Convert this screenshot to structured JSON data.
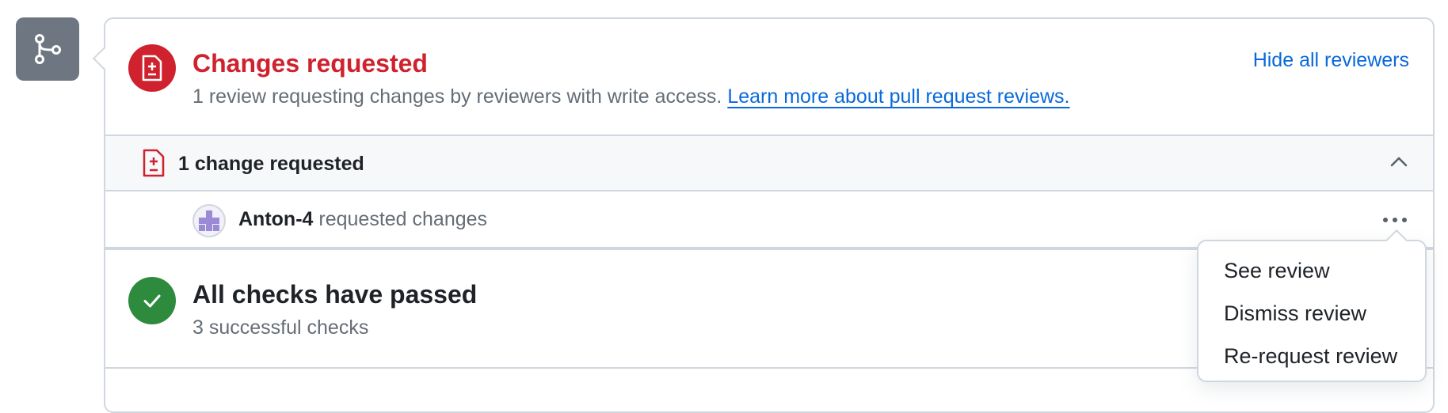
{
  "colors": {
    "danger": "#cf222e",
    "success": "#2e8b3e",
    "link": "#0969da",
    "muted": "#656d76",
    "icon_box": "#6e7781"
  },
  "icons": {
    "merge": "git-branch-icon",
    "changes": "file-diff-icon",
    "checks": "check-icon",
    "collapse": "chevron-up-icon",
    "more": "kebab-horizontal-icon"
  },
  "review_status": {
    "title": "Changes requested",
    "description": "1 review requesting changes by reviewers with write access.",
    "learn_more_link": "Learn more about pull request reviews.",
    "hide_reviewers_link": "Hide all reviewers"
  },
  "change_group": {
    "label": "1 change requested",
    "reviewers": [
      {
        "name": "Anton-4",
        "action": "requested changes"
      }
    ]
  },
  "checks": {
    "title": "All checks have passed",
    "summary": "3 successful checks"
  },
  "review_menu": {
    "items": [
      "See review",
      "Dismiss review",
      "Re-request review"
    ]
  }
}
